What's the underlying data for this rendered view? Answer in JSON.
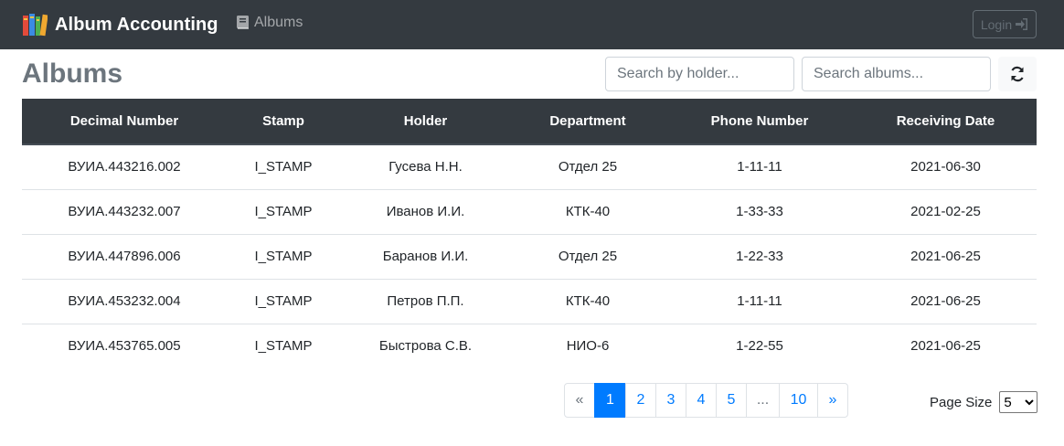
{
  "navbar": {
    "brand": "Album Accounting",
    "albums_link": "Albums",
    "login_label": "Login"
  },
  "page": {
    "title": "Albums",
    "search_holder_placeholder": "Search by holder...",
    "search_albums_placeholder": "Search albums..."
  },
  "table": {
    "columns": [
      "Decimal Number",
      "Stamp",
      "Holder",
      "Department",
      "Phone Number",
      "Receiving Date"
    ],
    "rows": [
      [
        "ВУИА.443216.002",
        "I_STAMP",
        "Гусева Н.Н.",
        "Отдел 25",
        "1-11-11",
        "2021-06-30"
      ],
      [
        "ВУИА.443232.007",
        "I_STAMP",
        "Иванов И.И.",
        "КТК-40",
        "1-33-33",
        "2021-02-25"
      ],
      [
        "ВУИА.447896.006",
        "I_STAMP",
        "Баранов И.И.",
        "Отдел 25",
        "1-22-33",
        "2021-06-25"
      ],
      [
        "ВУИА.453232.004",
        "I_STAMP",
        "Петров П.П.",
        "КТК-40",
        "1-11-11",
        "2021-06-25"
      ],
      [
        "ВУИА.453765.005",
        "I_STAMP",
        "Быстрова С.В.",
        "НИО-6",
        "1-22-55",
        "2021-06-25"
      ]
    ]
  },
  "pagination": {
    "prev": "«",
    "pages": [
      "1",
      "2",
      "3",
      "4",
      "5",
      "...",
      "10"
    ],
    "next": "»",
    "active": "1"
  },
  "page_size": {
    "label": "Page Size",
    "selected": "5"
  },
  "colors": {
    "navbar_bg": "#343a40",
    "accent": "#007bff",
    "title": "#6c757d"
  }
}
